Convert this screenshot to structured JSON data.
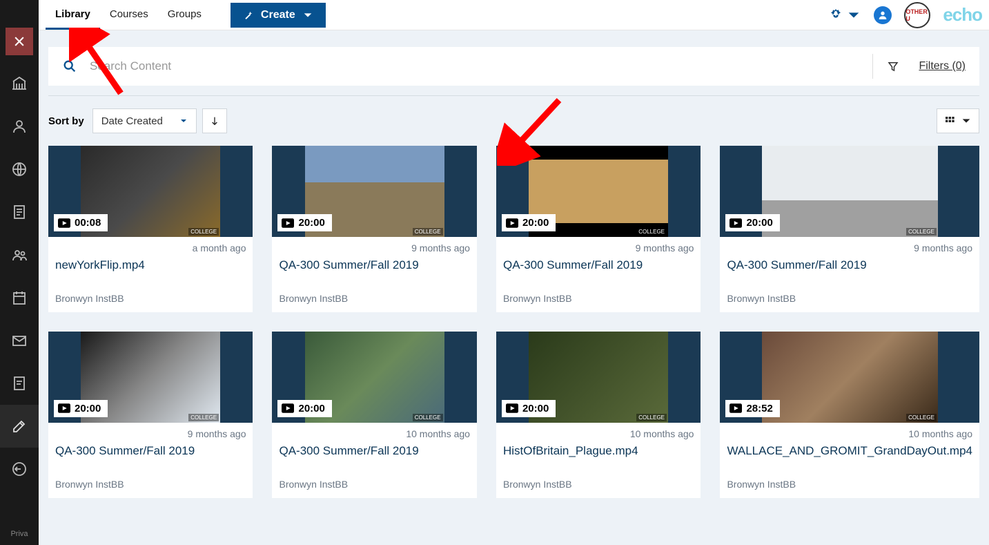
{
  "nav": {
    "tabs": [
      {
        "label": "Library",
        "active": true
      },
      {
        "label": "Courses",
        "active": false
      },
      {
        "label": "Groups",
        "active": false
      }
    ],
    "create_label": "Create"
  },
  "header": {
    "echo_brand": "echo",
    "org_abbrev": "OTHER U"
  },
  "search": {
    "placeholder": "Search Content",
    "value": "",
    "filters_label": "Filters (0)"
  },
  "toolbar": {
    "sort_label": "Sort by",
    "sort_value": "Date Created"
  },
  "sidebar": {
    "footer": "Priva"
  },
  "cards": [
    {
      "duration": "00:08",
      "date": "a month ago",
      "title": "newYorkFlip.mp4",
      "author": "Bronwyn InstBB",
      "thumb": "g1"
    },
    {
      "duration": "20:00",
      "date": "9 months ago",
      "title": "QA-300 Summer/Fall 2019",
      "author": "Bronwyn InstBB",
      "thumb": "g2"
    },
    {
      "duration": "20:00",
      "date": "9 months ago",
      "title": "QA-300 Summer/Fall 2019",
      "author": "Bronwyn InstBB",
      "thumb": "g3"
    },
    {
      "duration": "20:00",
      "date": "9 months ago",
      "title": "QA-300 Summer/Fall 2019",
      "author": "Bronwyn InstBB",
      "thumb": "g4"
    },
    {
      "duration": "20:00",
      "date": "9 months ago",
      "title": "QA-300 Summer/Fall 2019",
      "author": "Bronwyn InstBB",
      "thumb": "g5"
    },
    {
      "duration": "20:00",
      "date": "10 months ago",
      "title": "QA-300 Summer/Fall 2019",
      "author": "Bronwyn InstBB",
      "thumb": "g6"
    },
    {
      "duration": "20:00",
      "date": "10 months ago",
      "title": "HistOfBritain_Plague.mp4",
      "author": "Bronwyn InstBB",
      "thumb": "g7"
    },
    {
      "duration": "28:52",
      "date": "10 months ago",
      "title": "WALLACE_AND_GROMIT_GrandDayOut.mp4",
      "author": "Bronwyn InstBB",
      "thumb": "g8"
    }
  ],
  "watermark": "COLLEGE"
}
